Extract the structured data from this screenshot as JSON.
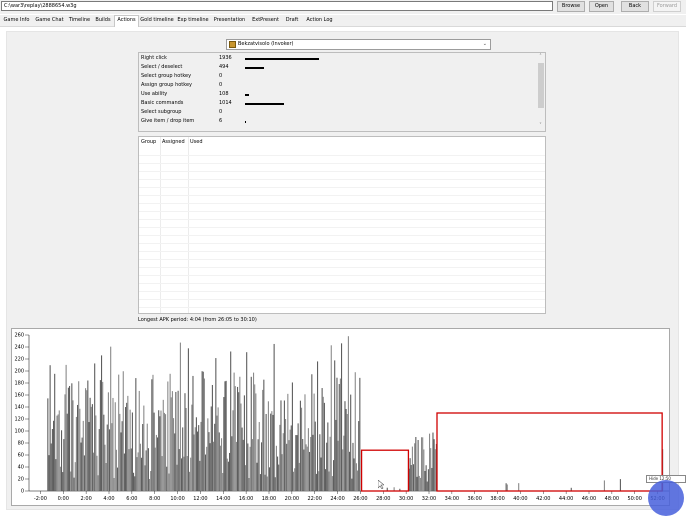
{
  "toolbar": {
    "path": "C:\\war3\\replay\\2888654.w3g",
    "browse": "Browse",
    "open": "Open",
    "back": "Back",
    "forward": "Forward"
  },
  "tabs": [
    "Game Info",
    "Game Chat",
    "Timeline",
    "Builds",
    "Actions",
    "Gold timeline",
    "Exp timeline",
    "Presentation",
    "ExtPresent",
    "Draft",
    "Action Log"
  ],
  "active_tab": "Actions",
  "player_select": {
    "value": "Bekzatvisolo (Invoker)"
  },
  "actions": [
    {
      "label": "Right click",
      "value": 1936
    },
    {
      "label": "Select / deselect",
      "value": 494
    },
    {
      "label": "Select group hotkey",
      "value": 0
    },
    {
      "label": "Assign group hotkey",
      "value": 0
    },
    {
      "label": "Use ability",
      "value": 108
    },
    {
      "label": "Basic commands",
      "value": 1014
    },
    {
      "label": "Select subgroup",
      "value": 0
    },
    {
      "label": "Give item / drop item",
      "value": 6
    }
  ],
  "group_table": {
    "headers": [
      "Group",
      "Assigned",
      "Used"
    ]
  },
  "apk_text": "Longest APK period: 4:04 (from 26:05 to 30:10)",
  "clock_text": "Hide 12:50",
  "colors": {
    "bar": "#707070",
    "highlight": "#d00000",
    "accent_circle": "#465fdc"
  },
  "chart_data": {
    "type": "bar",
    "y_ticks": [
      0,
      20,
      40,
      60,
      80,
      100,
      120,
      140,
      160,
      180,
      200,
      220,
      240,
      260
    ],
    "ylim": [
      0,
      260
    ],
    "x_ticks": [
      "-2:00",
      "0:00",
      "2:00",
      "4:00",
      "6:00",
      "8:00",
      "10:00",
      "12:00",
      "14:00",
      "16:00",
      "18:00",
      "20:00",
      "22:00",
      "24:00",
      "26:00",
      "28:00",
      "30:00",
      "32:00",
      "34:00",
      "36:00",
      "38:00",
      "40:00",
      "42:00",
      "44:00",
      "46:00",
      "48:00",
      "50:00",
      "52:00"
    ],
    "xlim": [
      -3,
      53
    ],
    "highlights": [
      {
        "from": 26.1,
        "to": 30.2,
        "y_max": 68
      },
      {
        "from": 32.7,
        "to": 52.4,
        "y_max": 130
      }
    ]
  }
}
